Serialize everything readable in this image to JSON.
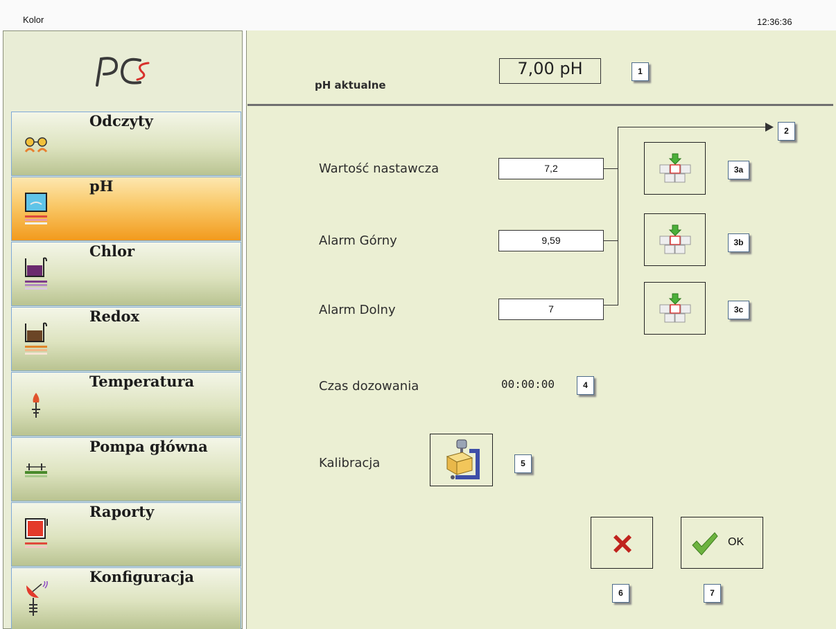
{
  "window": {
    "title": "Kolor",
    "clock": "12:36:36"
  },
  "logo": {
    "text": "PCS"
  },
  "sidebar": {
    "items": [
      {
        "label": "Odczyty",
        "icon": "glasses-icon"
      },
      {
        "label": "pH",
        "icon": "ph-beaker-icon",
        "active": true
      },
      {
        "label": "Chlor",
        "icon": "chlor-tank-icon"
      },
      {
        "label": "Redox",
        "icon": "redox-tank-icon"
      },
      {
        "label": "Temperatura",
        "icon": "thermometer-icon"
      },
      {
        "label": "Pompa główna",
        "icon": "pump-icon"
      },
      {
        "label": "Raporty",
        "icon": "reports-icon"
      },
      {
        "label": "Konfiguracja",
        "icon": "satellite-dish-icon"
      }
    ]
  },
  "main": {
    "ph_current": {
      "label": "pH aktualne",
      "value": "7,00 pH",
      "tag": "1"
    },
    "setpoint": {
      "label": "Wartość nastawcza",
      "value": "7,2",
      "tag": "3a"
    },
    "alarm_high": {
      "label": "Alarm Górny",
      "value": "9,59",
      "tag": "3b"
    },
    "alarm_low": {
      "label": "Alarm Dolny",
      "value": "7",
      "tag": "3c"
    },
    "connector_tag": "2",
    "dosing_time": {
      "label": "Czas dozowania",
      "value": "00:00:00",
      "tag": "4"
    },
    "calibration": {
      "label": "Kalibracja",
      "tag": "5"
    },
    "cancel": {
      "tag": "6"
    },
    "ok": {
      "label": "OK",
      "tag": "7"
    }
  },
  "colors": {
    "active_nav": "#f29a1d",
    "panel_bg": "#ebefd3",
    "cancel_red": "#c0231d",
    "ok_green": "#6db33f"
  }
}
